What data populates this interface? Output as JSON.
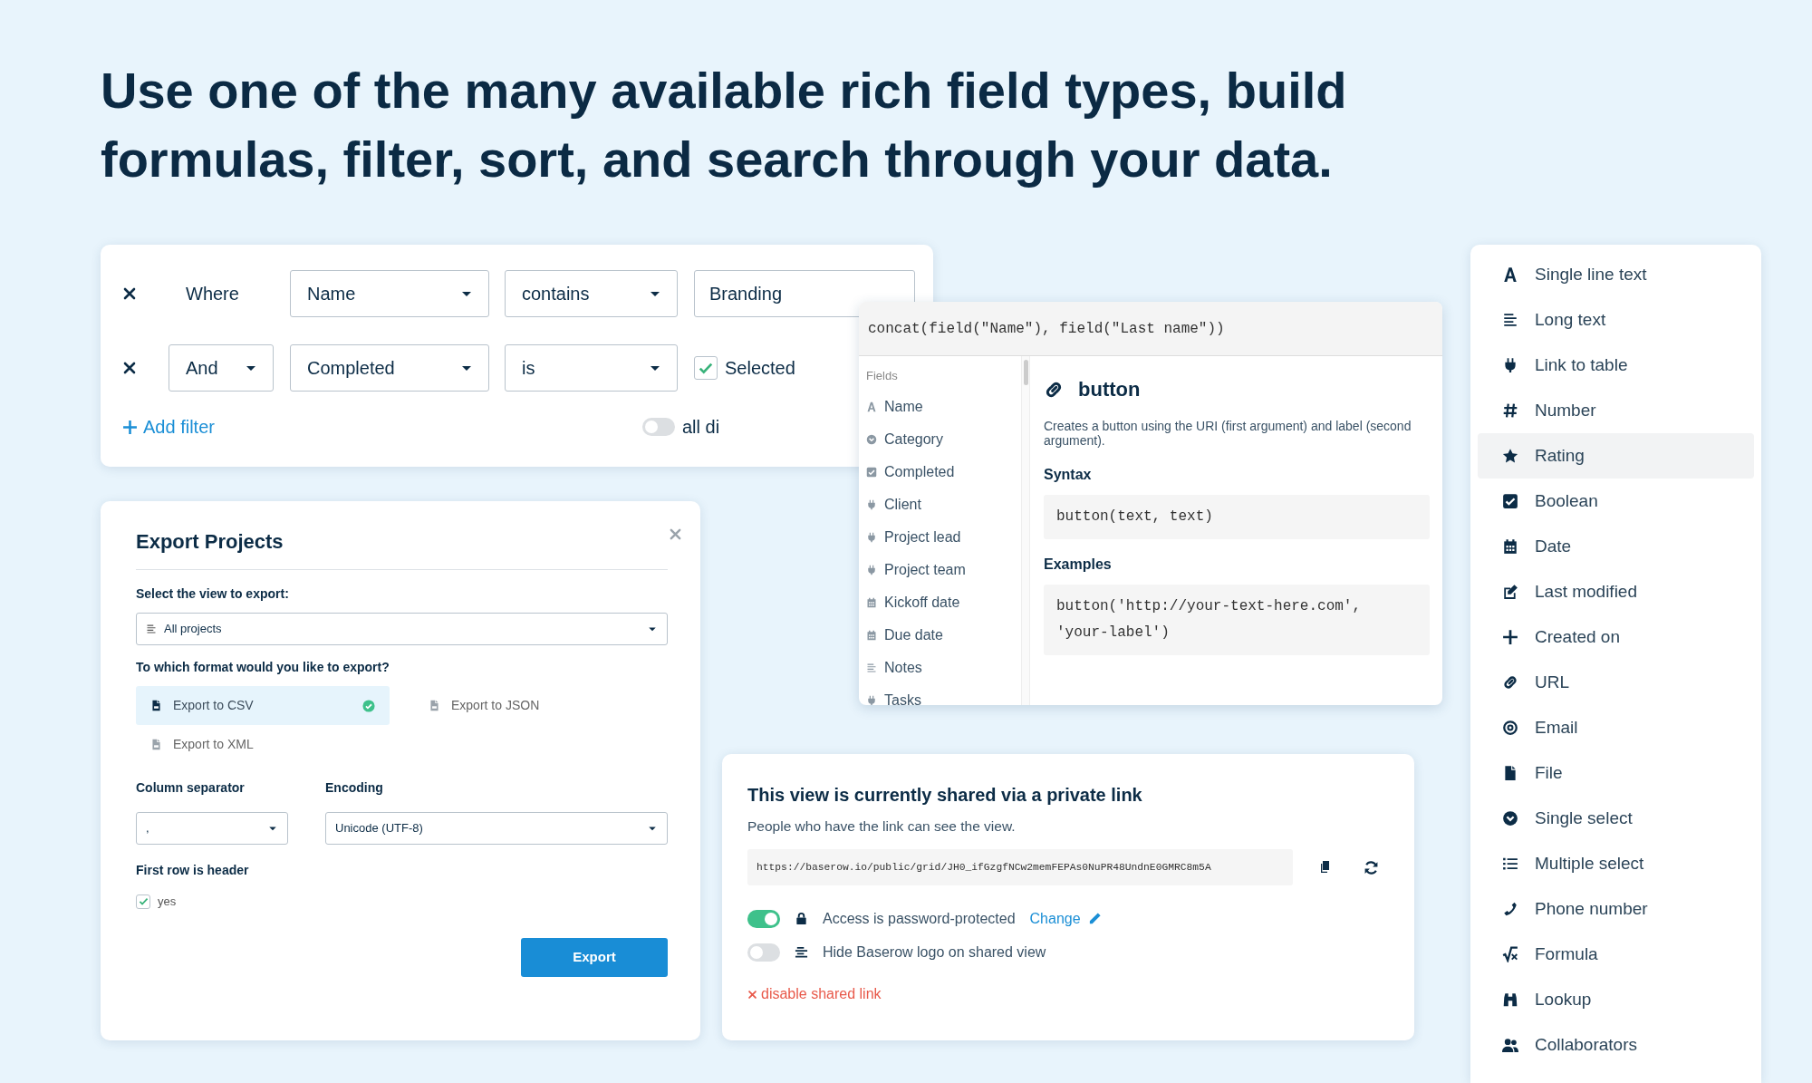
{
  "headline": "Use one of the many available rich field types, build formulas, filter, sort, and search through your data.",
  "filter": {
    "rows": [
      {
        "conjunction": {
          "kind": "label",
          "text": "Where"
        },
        "field": "Name",
        "operator": "contains",
        "value": {
          "kind": "text",
          "text": "Branding"
        }
      },
      {
        "conjunction": {
          "kind": "select",
          "text": "And"
        },
        "field": "Completed",
        "operator": "is",
        "value": {
          "kind": "checkbox",
          "text": "Selected",
          "checked": true
        }
      }
    ],
    "add_label": "Add filter",
    "toggle": {
      "label": "all di",
      "on": false
    }
  },
  "formula": {
    "expression": "concat(field(\"Name\"), field(\"Last name\"))",
    "fields_heading": "Fields",
    "fields": [
      "Name",
      "Category",
      "Completed",
      "Client",
      "Project lead",
      "Project team",
      "Kickoff date",
      "Due date",
      "Notes",
      "Tasks"
    ],
    "function": {
      "name": "button",
      "description": "Creates a button using the URI (first argument) and label (second argument).",
      "syntax_heading": "Syntax",
      "syntax": "button(text, text)",
      "examples_heading": "Examples",
      "example": "button('http://your-text-here.com', 'your-label')"
    }
  },
  "export": {
    "title": "Export Projects",
    "view_label": "Select the view to export:",
    "view": "All projects",
    "format_label": "To which format would you like to export?",
    "formats": [
      {
        "label": "Export to CSV",
        "selected": true
      },
      {
        "label": "Export to JSON",
        "selected": false
      },
      {
        "label": "Export to XML",
        "selected": false
      }
    ],
    "separator_label": "Column separator",
    "separator": ",",
    "encoding_label": "Encoding",
    "encoding": "Unicode (UTF-8)",
    "header_label": "First row is header",
    "header_option": {
      "label": "yes",
      "checked": true
    },
    "button": "Export"
  },
  "share": {
    "title": "This view is currently shared via a private link",
    "subtitle": "People who have the link can see the view.",
    "url": "https://baserow.io/public/grid/JH0_ifGzgfNCw2memFEPAs0NuPR48UndnE0GMRC8m5A",
    "options": [
      {
        "label": "Access is password-protected",
        "on": true,
        "link": "Change"
      },
      {
        "label": "Hide Baserow logo on shared view",
        "on": false
      }
    ],
    "disable": "disable shared link"
  },
  "field_types": [
    {
      "label": "Single line text",
      "selected": false
    },
    {
      "label": "Long text",
      "selected": false
    },
    {
      "label": "Link to table",
      "selected": false
    },
    {
      "label": "Number",
      "selected": false
    },
    {
      "label": "Rating",
      "selected": true
    },
    {
      "label": "Boolean",
      "selected": false
    },
    {
      "label": "Date",
      "selected": false
    },
    {
      "label": "Last modified",
      "selected": false
    },
    {
      "label": "Created on",
      "selected": false
    },
    {
      "label": "URL",
      "selected": false
    },
    {
      "label": "Email",
      "selected": false
    },
    {
      "label": "File",
      "selected": false
    },
    {
      "label": "Single select",
      "selected": false
    },
    {
      "label": "Multiple select",
      "selected": false
    },
    {
      "label": "Phone number",
      "selected": false
    },
    {
      "label": "Formula",
      "selected": false
    },
    {
      "label": "Lookup",
      "selected": false
    },
    {
      "label": "Collaborators",
      "selected": false
    }
  ]
}
